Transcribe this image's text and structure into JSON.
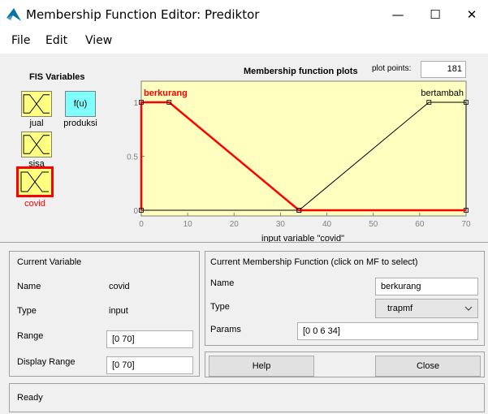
{
  "window": {
    "title": "Membership Function Editor: Prediktor",
    "minimize_glyph": "—",
    "maximize_glyph": "☐",
    "close_glyph": "✕"
  },
  "menu": [
    "File",
    "Edit",
    "View"
  ],
  "fis_variables": {
    "title": "FIS Variables",
    "items": [
      {
        "label": "jual",
        "kind": "input-mf-icon",
        "selected": false
      },
      {
        "label": "produksi",
        "kind": "output-fx-box",
        "box_text": "f(u)",
        "selected": false
      },
      {
        "label": "sisa",
        "kind": "input-mf-icon",
        "selected": false
      },
      {
        "label": "covid",
        "kind": "input-mf-icon",
        "selected": true
      }
    ]
  },
  "plot": {
    "title": "Membership function plots",
    "plot_points_label": "plot points:",
    "plot_points_value": "181",
    "xlabel": "input variable \"covid\"",
    "x_ticks": [
      "0",
      "10",
      "20",
      "30",
      "40",
      "50",
      "60",
      "70"
    ],
    "y_ticks": [
      "0",
      "0.5",
      "1"
    ],
    "xlim": [
      0,
      70
    ],
    "ylim": [
      0,
      1
    ],
    "background_color": "#ffffc0",
    "selected_color": "#ff0000",
    "mfs": [
      {
        "name": "berkurang",
        "type": "trapmf",
        "params": [
          0,
          0,
          6,
          34
        ],
        "selected": true
      },
      {
        "name": "bertambah",
        "type": "trapmf",
        "params": [
          34,
          62,
          70,
          70
        ],
        "selected": false
      }
    ]
  },
  "current_variable": {
    "title": "Current Variable",
    "name_label": "Name",
    "name_value": "covid",
    "type_label": "Type",
    "type_value": "input",
    "range_label": "Range",
    "range_value": "[0 70]",
    "display_range_label": "Display Range",
    "display_range_value": "[0 70]"
  },
  "current_mf": {
    "title": "Current Membership Function (click on MF to select)",
    "name_label": "Name",
    "name_value": "berkurang",
    "type_label": "Type",
    "type_value": "trapmf",
    "params_label": "Params",
    "params_value": "[0 0 6 34]"
  },
  "buttons": {
    "help": "Help",
    "close": "Close"
  },
  "status": "Ready"
}
